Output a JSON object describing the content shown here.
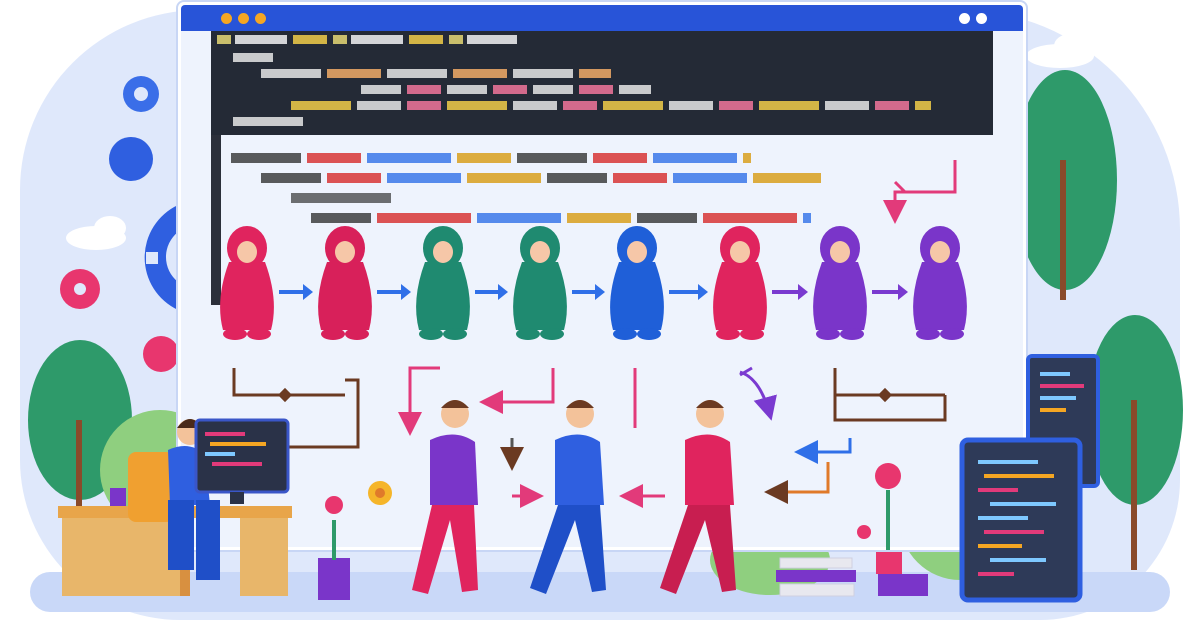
{
  "illustration": {
    "window_dots": [
      "#f5a623",
      "#f5a623",
      "#f5a623",
      "#ffffff",
      "#ffffff"
    ],
    "colors": {
      "titlebar": "#2854d8",
      "pink": "#e0245e",
      "green": "#1f8a70",
      "blue": "#1f5fd8",
      "purple": "#7a35c9",
      "arrow_blue": "#2f6fe8",
      "arrow_purple": "#7a3ad0",
      "arrow_pink": "#e23a7a",
      "arrow_brown": "#6b3a22",
      "tree": "#2e9a6a",
      "gear_blue": "#3a6ee8",
      "gear_pink": "#e8366e"
    },
    "figure_colors": [
      "#e0245e",
      "#d8205a",
      "#1f8a70",
      "#1f8a70",
      "#1f5fd8",
      "#e0245e",
      "#7a35c9",
      "#7a35c9"
    ],
    "icons": [
      "gear-icon",
      "cloud-icon",
      "flower-icon",
      "tree-icon"
    ]
  }
}
